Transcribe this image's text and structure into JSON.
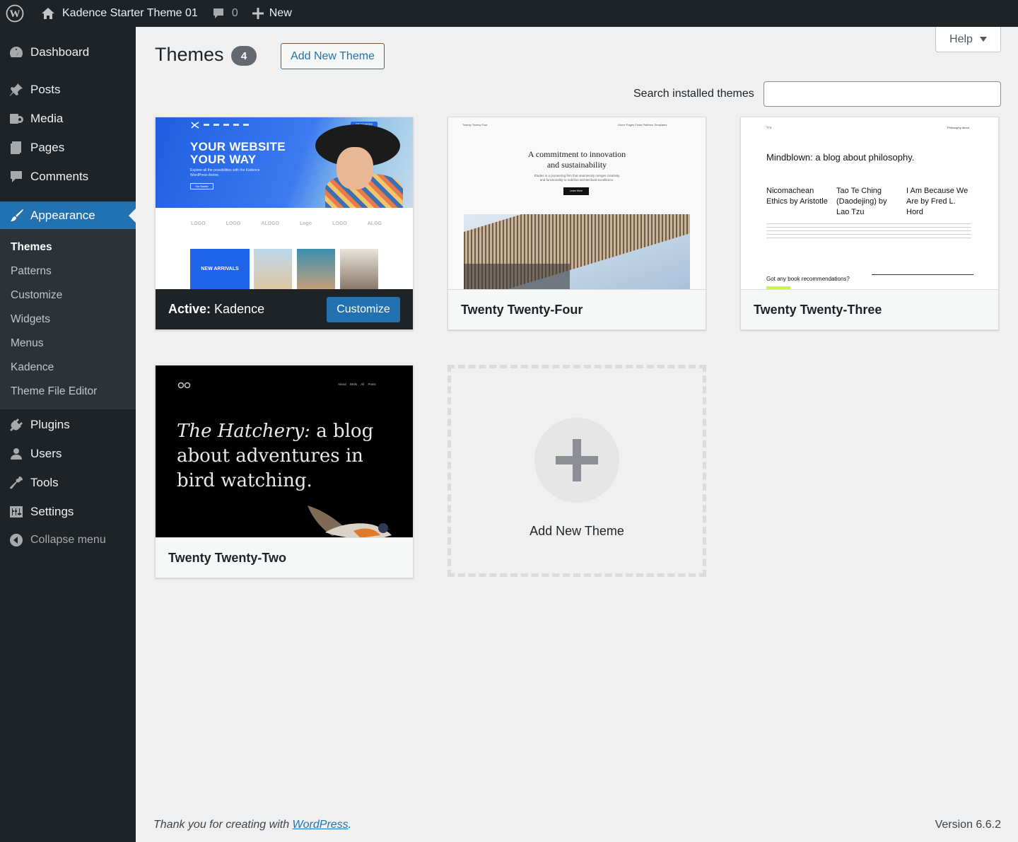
{
  "adminbar": {
    "site_name": "Kadence Starter Theme 01",
    "comments_count": "0",
    "new_label": "New"
  },
  "sidebar": {
    "items": [
      {
        "label": "Dashboard",
        "icon": "dashboard-icon"
      },
      {
        "label": "Posts",
        "icon": "pin-icon"
      },
      {
        "label": "Media",
        "icon": "media-icon"
      },
      {
        "label": "Pages",
        "icon": "pages-icon"
      },
      {
        "label": "Comments",
        "icon": "comment-icon"
      },
      {
        "label": "Appearance",
        "icon": "brush-icon"
      },
      {
        "label": "Plugins",
        "icon": "plug-icon"
      },
      {
        "label": "Users",
        "icon": "user-icon"
      },
      {
        "label": "Tools",
        "icon": "wrench-icon"
      },
      {
        "label": "Settings",
        "icon": "sliders-icon"
      }
    ],
    "submenu": [
      "Themes",
      "Patterns",
      "Customize",
      "Widgets",
      "Menus",
      "Kadence",
      "Theme File Editor"
    ],
    "collapse_label": "Collapse menu"
  },
  "page": {
    "title": "Themes",
    "count": "4",
    "add_new_label": "Add New Theme",
    "help_label": "Help",
    "search_label": "Search installed themes",
    "search_value": ""
  },
  "themes": {
    "active": {
      "prefix": "Active:",
      "name": "Kadence",
      "customize_label": "Customize",
      "shot": {
        "headline_1": "YOUR WEBSITE",
        "headline_2": "YOUR WAY",
        "subtext": "Explore all the possibilities with the Kadence WordPress theme.",
        "button": "Get Started",
        "logos": [
          "LOGO",
          "LOGO",
          "ALOGO",
          "Logo",
          "LOGO",
          "ALOG"
        ],
        "tile_text": "NEW ARRIVALS",
        "nav_button": "GET STARTED"
      }
    },
    "t24": {
      "name": "Twenty Twenty-Four",
      "shot": {
        "brand": "Twenty Twenty Four",
        "nav": "Home   Pages   Posts   Patterns   Templates",
        "headline_1": "A commitment to innovation",
        "headline_2": "and sustainability",
        "body": "Études is a pioneering firm that seamlessly merges creativity and functionality to redefine architectural excellence.",
        "button": "Learn More"
      }
    },
    "t23": {
      "name": "Twenty Twenty-Three",
      "shot": {
        "brand": "TT3",
        "nav": "Philosophy   About",
        "headline": "Mindblown: a blog about philosophy.",
        "col1": "Nicomachean Ethics by Aristotle",
        "col2": "Tao Te Ching (Daodejing) by Lao Tzu",
        "col3": "I Am Because We Are by Fred L. Hord",
        "footer": "Got any book recommendations?"
      }
    },
    "t22": {
      "name": "Twenty Twenty-Two",
      "shot": {
        "nav": "About   Birds   All Posts",
        "headline_italic": "The Hatchery:",
        "headline_rest": " a blog about adventures in bird watching."
      }
    },
    "add_label": "Add New Theme"
  },
  "footer": {
    "thanks_prefix": "Thank you for creating with ",
    "thanks_link": "WordPress",
    "thanks_suffix": ".",
    "version": "Version 6.6.2"
  },
  "colors": {
    "accent": "#2271b1",
    "sidebar_bg": "#1d2327",
    "page_bg": "#f0f0f1"
  }
}
